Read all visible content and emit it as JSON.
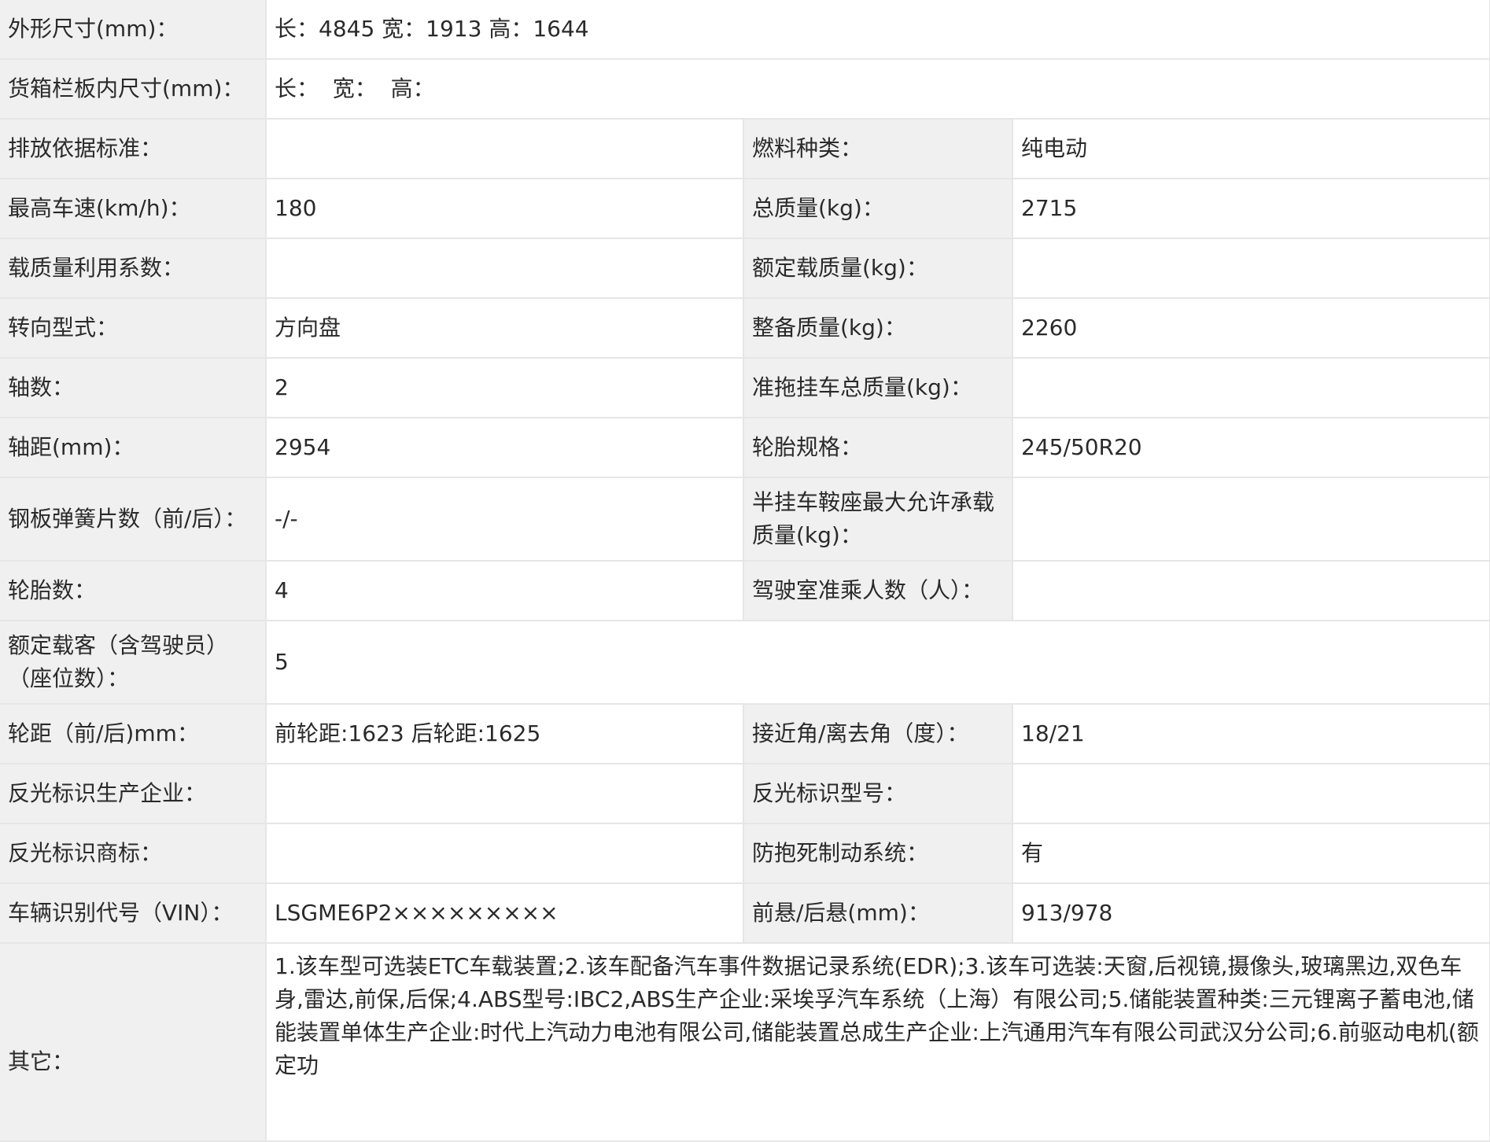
{
  "rows": {
    "dimensions": {
      "label": "外形尺寸(mm)：",
      "value": "长：4845 宽：1913 高：1644"
    },
    "cargo_box": {
      "label": "货箱栏板内尺寸(mm)：",
      "value": "长：  宽：  高："
    },
    "emission_standard": {
      "label": "排放依据标准：",
      "value": ""
    },
    "fuel_type": {
      "label": "燃料种类：",
      "value": "纯电动"
    },
    "max_speed": {
      "label": "最高车速(km/h)：",
      "value": "180"
    },
    "gross_mass": {
      "label": "总质量(kg)：",
      "value": "2715"
    },
    "load_factor": {
      "label": "载质量利用系数：",
      "value": ""
    },
    "rated_load": {
      "label": "额定载质量(kg)：",
      "value": ""
    },
    "steering": {
      "label": "转向型式：",
      "value": "方向盘"
    },
    "curb_mass": {
      "label": "整备质量(kg)：",
      "value": "2260"
    },
    "axles": {
      "label": "轴数：",
      "value": "2"
    },
    "trailer_mass": {
      "label": "准拖挂车总质量(kg)：",
      "value": ""
    },
    "wheelbase": {
      "label": "轴距(mm)：",
      "value": "2954"
    },
    "tire_spec": {
      "label": "轮胎规格：",
      "value": "245/50R20"
    },
    "leaf_springs": {
      "label": "钢板弹簧片数（前/后）：",
      "value": "-/-"
    },
    "saddle_load": {
      "label": "半挂车鞍座最大允许承载质量(kg)：",
      "value": ""
    },
    "tire_count": {
      "label": "轮胎数：",
      "value": "4"
    },
    "cab_passengers": {
      "label": "驾驶室准乘人数（人）：",
      "value": ""
    },
    "rated_passengers": {
      "label": "额定载客（含驾驶员）（座位数）：",
      "value": "5"
    },
    "track": {
      "label": "轮距（前/后)mm：",
      "value": "前轮距:1623 后轮距:1625"
    },
    "angles": {
      "label": "接近角/离去角（度）：",
      "value": "18/21"
    },
    "reflector_maker": {
      "label": "反光标识生产企业：",
      "value": ""
    },
    "reflector_model": {
      "label": "反光标识型号：",
      "value": ""
    },
    "reflector_brand": {
      "label": "反光标识商标：",
      "value": ""
    },
    "abs": {
      "label": "防抱死制动系统：",
      "value": "有"
    },
    "vin": {
      "label": "车辆识别代号（VIN）：",
      "value": "LSGME6P2×××××××××"
    },
    "overhang": {
      "label": "前悬/后悬(mm)：",
      "value": "913/978"
    },
    "other": {
      "label": "其它：",
      "value": "1.该车型可选装ETC车载装置;2.该车配备汽车事件数据记录系统(EDR);3.该车可选装:天窗,后视镜,摄像头,玻璃黑边,双色车身,雷达,前保,后保;4.ABS型号:IBC2,ABS生产企业:采埃孚汽车系统（上海）有限公司;5.储能装置种类:三元锂离子蓄电池,储能装置单体生产企业:时代上汽动力电池有限公司,储能装置总成生产企业:上汽通用汽车有限公司武汉分公司;6.前驱动电机(额定功"
    }
  }
}
